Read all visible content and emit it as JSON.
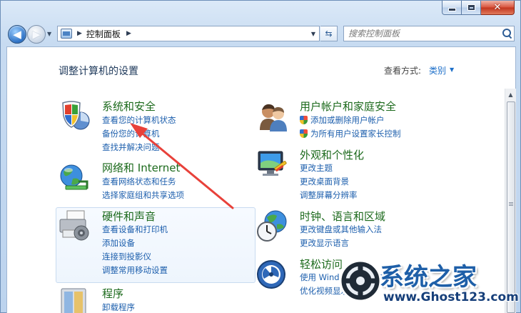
{
  "window": {
    "caption_close": "✕"
  },
  "address_bar": {
    "path_label": "控制面板"
  },
  "search": {
    "placeholder": "搜索控制面板"
  },
  "page": {
    "title": "调整计算机的设置",
    "view_by_label": "查看方式:",
    "view_by_value": "类别"
  },
  "categories": {
    "system_security": {
      "title": "系统和安全",
      "links": [
        "查看您的计算机状态",
        "备份您的计算机",
        "查找并解决问题"
      ]
    },
    "network_internet": {
      "title": "网络和 Internet",
      "links": [
        "查看网络状态和任务",
        "选择家庭组和共享选项"
      ]
    },
    "hardware_sound": {
      "title": "硬件和声音",
      "links": [
        "查看设备和打印机",
        "添加设备",
        "连接到投影仪",
        "调整常用移动设置"
      ]
    },
    "programs": {
      "title": "程序",
      "links": [
        "卸载程序"
      ]
    },
    "user_accounts": {
      "title": "用户帐户和家庭安全",
      "links": [
        "添加或删除用户帐户",
        "为所有用户设置家长控制"
      ]
    },
    "appearance": {
      "title": "外观和个性化",
      "links": [
        "更改主题",
        "更改桌面背景",
        "调整屏幕分辨率"
      ]
    },
    "clock_language": {
      "title": "时钟、语言和区域",
      "links": [
        "更改键盘或其他输入法",
        "更改显示语言"
      ]
    },
    "ease_of_access": {
      "title": "轻松访问",
      "links": [
        "使用 Windows 建议的设置",
        "优化视频显示"
      ]
    }
  },
  "watermark": {
    "title": "系统之家",
    "url": "www.Ghost123.com"
  },
  "colors": {
    "category_heading": "#1c6a1c",
    "link": "#1d5fad",
    "annotation_arrow": "#e8413a"
  }
}
